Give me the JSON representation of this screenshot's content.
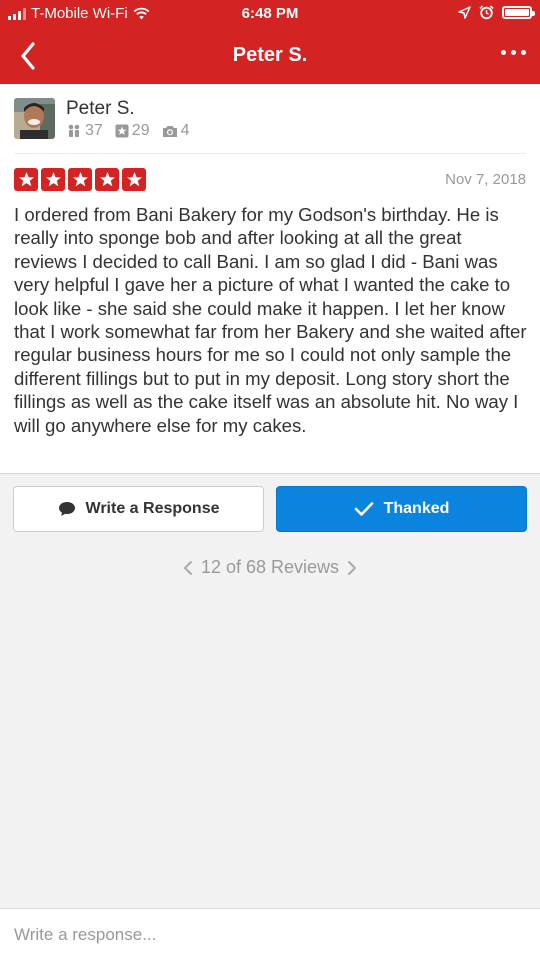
{
  "status_bar": {
    "carrier": "T-Mobile Wi-Fi",
    "time": "6:48 PM",
    "icons": [
      "signal-icon",
      "wifi-icon",
      "location-arrow-icon",
      "alarm-icon",
      "battery-icon"
    ]
  },
  "nav": {
    "title": "Peter S.",
    "back_icon": "chevron-left-icon",
    "more_icon": "more-horizontal-icon"
  },
  "review": {
    "user": {
      "name": "Peter S.",
      "friends": "37",
      "reviews": "29",
      "photos": "4"
    },
    "rating": 5,
    "date": "Nov 7, 2018",
    "text": "I ordered from Bani Bakery for my Godson's birthday. He is really into sponge bob and after looking at all the great reviews I decided to call Bani. I am so glad I did - Bani was very helpful I gave her a picture of what I wanted the cake to look like - she said she could make it happen. I let her know that I work somewhat far from her Bakery and she waited after regular business hours for me so I could not only sample the different fillings but to put in my deposit. Long story short the fillings as well as the cake itself was an absolute hit. No way I will go anywhere else for my cakes."
  },
  "actions": {
    "write_response_label": "Write a Response",
    "thanked_label": "Thanked"
  },
  "pager": {
    "label": "12 of 68 Reviews"
  },
  "response_input": {
    "placeholder": "Write a response..."
  },
  "colors": {
    "brand_red": "#d32323",
    "thanked_blue": "#0b84e0",
    "background": "#f2f2f2"
  }
}
